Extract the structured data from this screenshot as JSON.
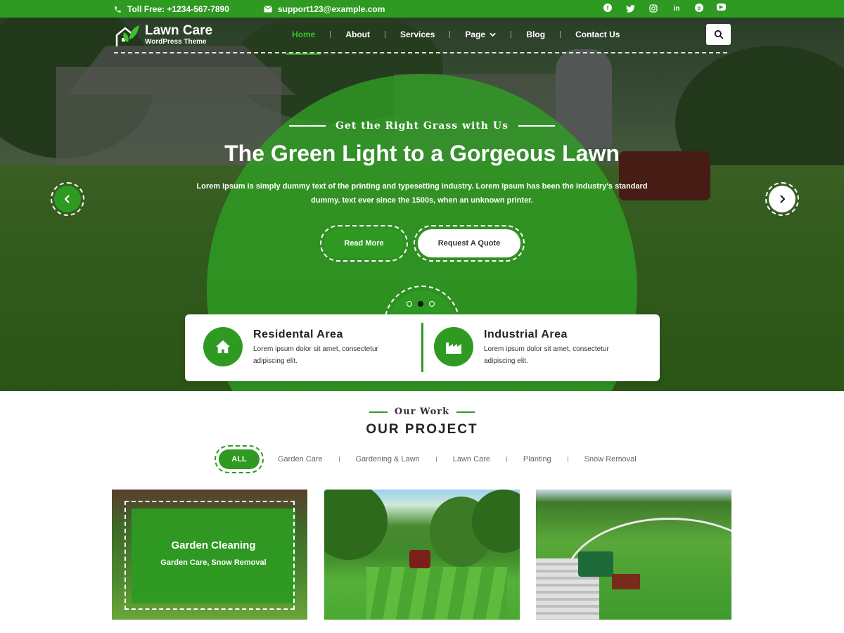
{
  "topbar": {
    "phone": "Toll Free: +1234-567-7890",
    "email": "support123@example.com",
    "social_icons": [
      "facebook-icon",
      "twitter-icon",
      "instagram-icon",
      "linkedin-icon",
      "pinterest-icon",
      "youtube-icon"
    ]
  },
  "header": {
    "logo_name": "Lawn Care",
    "logo_tagline": "WordPress Theme",
    "nav": [
      {
        "label": "Home",
        "active": true
      },
      {
        "label": "About",
        "active": false
      },
      {
        "label": "Services",
        "active": false
      },
      {
        "label": "Page",
        "active": false
      },
      {
        "label": "Blog",
        "active": false
      },
      {
        "label": "Contact Us",
        "active": false
      }
    ]
  },
  "hero": {
    "subtitle": "Get the Right Grass with Us",
    "title": "The Green Light to a Gorgeous Lawn",
    "text": "Lorem Ipsum is simply dummy text of the printing and typesetting industry. Lorem Ipsum has been the industry's standard dummy. text ever since the 1500s, when an unknown printer.",
    "read_more": "Read More",
    "quote": "Request A Quote"
  },
  "features": [
    {
      "title": "Residental Area",
      "text": "Lorem ipsum dolor sit amet, consectetur adipiscing elit."
    },
    {
      "title": "Industrial Area",
      "text": "Lorem ipsum dolor sit amet, consectetur adipiscing elit."
    }
  ],
  "projects": {
    "subtitle": "Our Work",
    "title": "OUR PROJECT",
    "filters": [
      "ALL",
      "Garden Care",
      "Gardening & Lawn",
      "Lawn Care",
      "Planting",
      "Snow Removal"
    ],
    "cards": [
      {
        "title": "Garden Cleaning",
        "tags": "Garden Care, Snow Removal"
      }
    ]
  },
  "colors": {
    "accent": "#2e9a22",
    "white": "#ffffff"
  }
}
